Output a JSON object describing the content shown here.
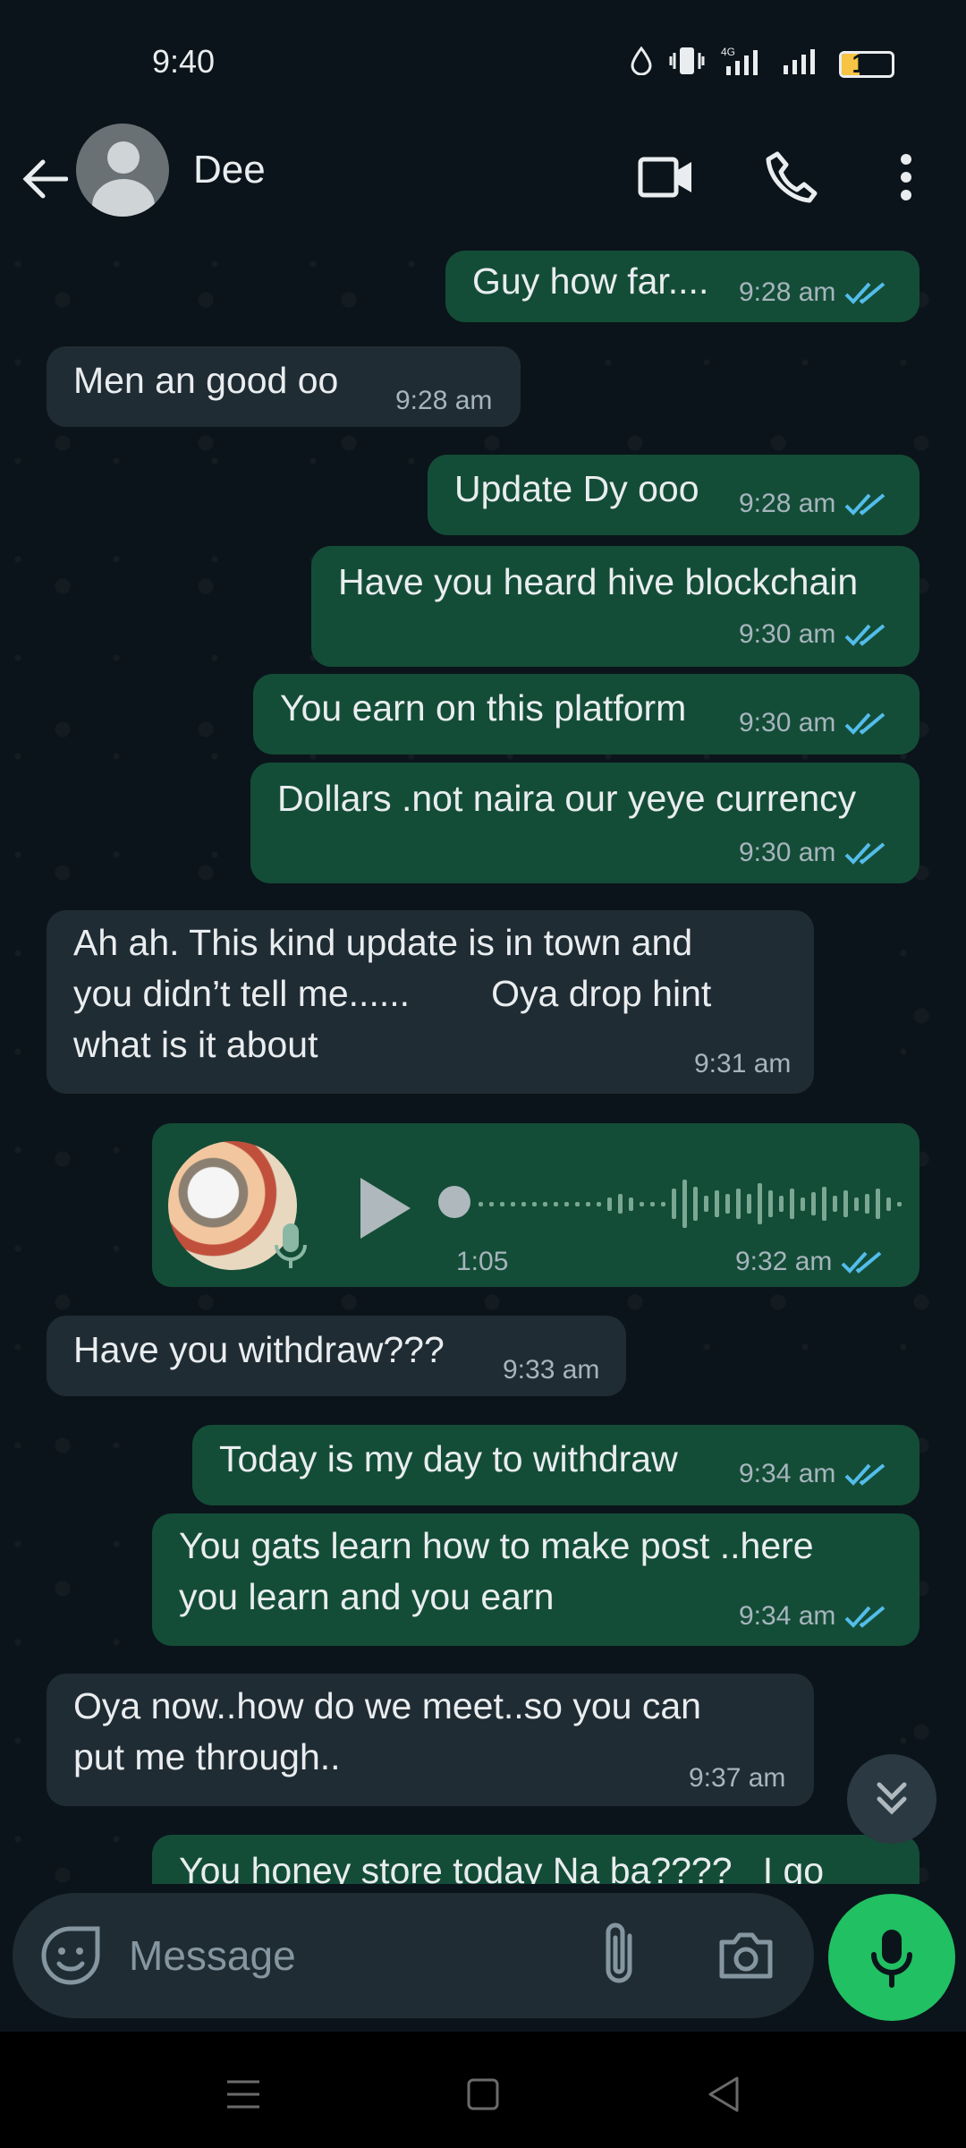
{
  "status_bar": {
    "time": "9:40",
    "network": "4G",
    "battery": "14"
  },
  "header": {
    "contact_name": "Dee"
  },
  "messages": [
    {
      "dir": "out",
      "text": "Guy how far....",
      "time": "9:28 am"
    },
    {
      "dir": "in",
      "text": "Men an good oo",
      "time": "9:28 am"
    },
    {
      "dir": "out",
      "text": "Update Dy ooo",
      "time": "9:28 am"
    },
    {
      "dir": "out",
      "text": "Have you heard hive blockchain",
      "time": "9:30 am"
    },
    {
      "dir": "out",
      "text": "You earn on this platform",
      "time": "9:30 am"
    },
    {
      "dir": "out",
      "text": "Dollars .not naira our yeye currency",
      "time": "9:30 am"
    },
    {
      "dir": "in",
      "text": "Ah ah. This kind update is in town and\nyou didn’t tell me......        Oya drop hint\nwhat is it about",
      "time": "9:31 am"
    },
    {
      "dir": "out",
      "type": "voice",
      "duration": "1:05",
      "time": "9:32 am"
    },
    {
      "dir": "in",
      "text": "Have you withdraw???",
      "time": "9:33 am"
    },
    {
      "dir": "out",
      "text": "Today is my day to withdraw",
      "time": "9:34 am"
    },
    {
      "dir": "out",
      "text": "You gats learn how to make post ..here\nyou learn and you earn",
      "time": "9:34 am"
    },
    {
      "dir": "in",
      "text": "Oya now..how do we meet..so you can\nput me through..",
      "time": "9:37 am"
    },
    {
      "dir": "out",
      "text": "You honey store today Na ba????   I go",
      "time": ""
    }
  ],
  "input": {
    "placeholder": "Message"
  },
  "colors": {
    "outgoing_bubble": "#144d37",
    "incoming_bubble": "#202c33",
    "read_ticks": "#53bdeb",
    "accent": "#21c063"
  }
}
